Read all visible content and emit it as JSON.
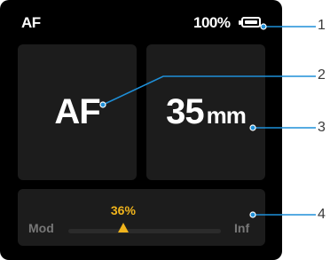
{
  "status": {
    "mode": "AF",
    "battery_percent": "100%",
    "battery_level": 1.0
  },
  "focus_mode_card": {
    "value": "AF"
  },
  "focal_length_card": {
    "value": "35",
    "unit": "mm"
  },
  "focus_position": {
    "percent_label": "36%",
    "min_label": "Mod",
    "max_label": "Inf",
    "level": 0.36,
    "accent_color": "#f0b41c"
  },
  "callouts": [
    "1",
    "2",
    "3",
    "4"
  ],
  "colors": {
    "screen": "#000000",
    "card": "#1c1c1c",
    "callout_line": "#1e8fd8"
  }
}
